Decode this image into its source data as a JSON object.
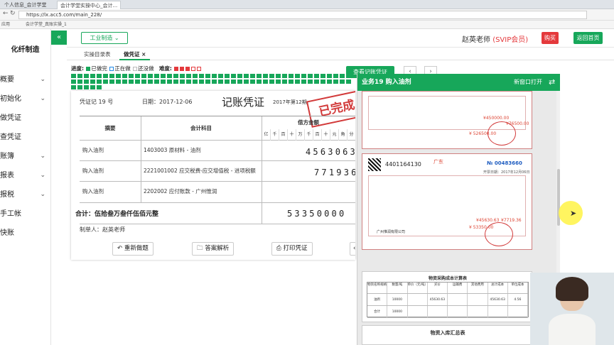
{
  "browser": {
    "tabs": [
      "个人信息_会计学堂",
      "会计学堂实操中心_会计...",
      ""
    ],
    "url": "https://lx.acc5.com/main_228/",
    "bookmarks": [
      "应用",
      "会计学堂_真账实操_1"
    ]
  },
  "sidebar": {
    "title": "化纤制造",
    "items": [
      {
        "label": "概要",
        "chevron": "⌄"
      },
      {
        "label": "初始化",
        "chevron": "⌄"
      },
      {
        "label": "做凭证",
        "chevron": ""
      },
      {
        "label": "查凭证",
        "chevron": ""
      },
      {
        "label": "账簿",
        "chevron": "⌄"
      },
      {
        "label": "报表",
        "chevron": "⌄"
      },
      {
        "label": "报税",
        "chevron": "⌄"
      },
      {
        "label": "手工帐",
        "chevron": ""
      },
      {
        "label": "快账",
        "chevron": ""
      }
    ]
  },
  "topbar": {
    "collapse_icon": "«",
    "dept_label": "工业制造 ⌄",
    "user": "赵英老师",
    "vip": "(SVIP会员)",
    "buy": "购买",
    "home": "返回首页"
  },
  "subtabs": [
    "实操目录表",
    "做凭证 ×"
  ],
  "progress": {
    "label": "进度:",
    "done": "已做完",
    "doing": "正在做",
    "todo": "还没做",
    "difficulty_label": "难度:",
    "difficulty_stars": 3,
    "done_cells": 93,
    "colors": {
      "done": "#17a75a",
      "doing": "#1e88e5",
      "todo": "#bbbbbb",
      "star": "#e4393c"
    }
  },
  "nav": {
    "view_btn": "查看记账凭证",
    "prev": "‹",
    "next": "›"
  },
  "voucher": {
    "number": "凭证记 19 号",
    "date": "日期：2017-12-06",
    "title": "记账凭证",
    "period": "2017年第12期",
    "stamp": "已完成",
    "col_summary": "摘要",
    "col_account": "会计科目",
    "col_debit": "借方金额",
    "digit_labels": [
      "亿",
      "千",
      "百",
      "十",
      "万",
      "千",
      "百",
      "十",
      "元",
      "角",
      "分"
    ],
    "rows": [
      {
        "summary": "购入油剂",
        "account": "1403003 原材料 - 油剂",
        "amount": "4563063"
      },
      {
        "summary": "购入油剂",
        "account": "2221001002 应交税费-应交增值税 - 进项税额",
        "amount": "771936"
      },
      {
        "summary": "购入油剂",
        "account": "2202002 应付账款 - 广州惟润",
        "amount": ""
      }
    ],
    "total_label": "合计：伍拾叁万叁仟伍佰元整",
    "total_amount": "53350000",
    "maker": "制单人：赵英老师",
    "buttons": [
      "↶ 重新做题",
      "答案解析",
      "打印凭证",
      "‹"
    ]
  },
  "panel": {
    "title": "业务19 购入油剂",
    "open_new": "新窗口打开",
    "swap_icon": "⇄",
    "invoice1": {
      "total_small": "¥ 526500.00",
      "amount": "¥450000.00",
      "tax": "¥76500.00"
    },
    "invoice2": {
      "code": "4401164130",
      "no": "№ 00483660",
      "province": "广东",
      "date": "开票日期：2017年12月06日",
      "amount": "¥45630.63",
      "tax": "¥7719.36",
      "total": "¥ 53350.00",
      "seller": "广州惟润有限公司"
    },
    "cost_table": {
      "title": "物资采购成本计算表",
      "headers": [
        "物资名称规格",
        "数量/吨",
        "单价（元/吨）",
        "买价",
        "运输费",
        "其他费用",
        "总计成本",
        "单位成本"
      ],
      "row": [
        "油剂",
        "10000",
        "",
        "45630.63",
        "",
        "",
        "45630.63",
        "4.56"
      ],
      "total": [
        "合计",
        "10000",
        "",
        "",
        "",
        "",
        "",
        ""
      ]
    },
    "summary_title": "物资入库汇总表"
  }
}
